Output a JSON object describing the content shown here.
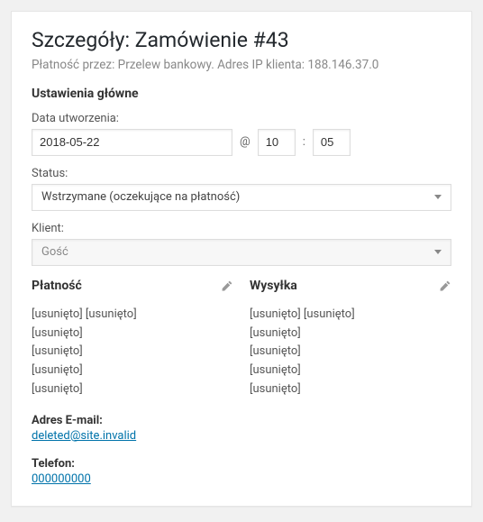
{
  "header": {
    "title": "Szczegóły: Zamówienie #43",
    "subtitle": "Płatność przez: Przelew bankowy. Adres IP klienta: 188.146.37.0"
  },
  "settings": {
    "heading": "Ustawienia główne",
    "date_label": "Data utworzenia:",
    "date_value": "2018-05-22",
    "at_symbol": "@",
    "hour": "10",
    "colon": ":",
    "minute": "05",
    "status_label": "Status:",
    "status_value": "Wstrzymane (oczekujące na płatność)",
    "client_label": "Klient:",
    "client_value": "Gość"
  },
  "payment": {
    "heading": "Płatność",
    "lines": [
      "[usunięto] [usunięto]",
      "[usunięto]",
      "[usunięto]",
      "[usunięto]",
      "[usunięto]"
    ],
    "email_label": "Adres E-mail:",
    "email_value": "deleted@site.invalid",
    "phone_label": "Telefon:",
    "phone_value": "000000000"
  },
  "shipping": {
    "heading": "Wysyłka",
    "lines": [
      "[usunięto] [usunięto]",
      "[usunięto]",
      "[usunięto]",
      "[usunięto]",
      "[usunięto]"
    ]
  }
}
